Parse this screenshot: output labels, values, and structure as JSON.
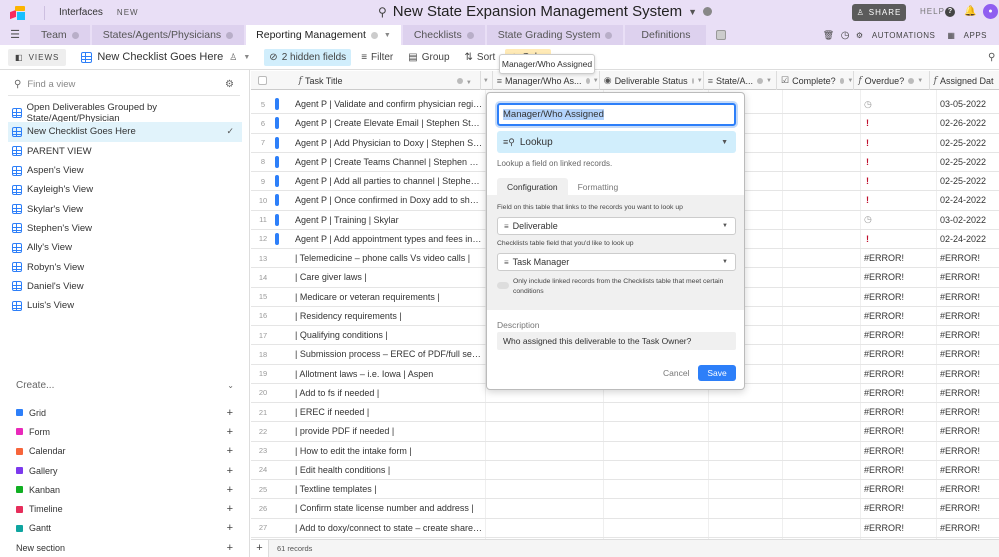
{
  "topbar": {
    "interfaces_label": "Interfaces",
    "new_badge": "NEW",
    "base_title": "New State Expansion Management System",
    "share_label": "SHARE",
    "help_label": "HELP"
  },
  "tabs": [
    {
      "label": "Team",
      "active": false
    },
    {
      "label": "States/Agents/Physicians",
      "active": false
    },
    {
      "label": "Reporting Management",
      "active": true
    },
    {
      "label": "Checklists",
      "active": false
    },
    {
      "label": "State Grading System",
      "active": false
    },
    {
      "label": "Definitions",
      "active": false
    }
  ],
  "tab_actions": {
    "automations_label": "AUTOMATIONS",
    "apps_label": "APPS"
  },
  "toolbar": {
    "views_label": "VIEWS",
    "current_view": "New Checklist Goes Here",
    "hidden_fields_label": "2 hidden fields",
    "filter_label": "Filter",
    "group_label": "Group",
    "sort_label": "Sort",
    "color_label": "Color"
  },
  "tooltip": "Manager/Who Assigned",
  "sidebar": {
    "find_placeholder": "Find a view",
    "views": [
      {
        "label": "Open Deliverables Grouped by State/Agent/Physician",
        "active": false
      },
      {
        "label": "New Checklist Goes Here",
        "active": true
      },
      {
        "label": "PARENT VIEW",
        "active": false
      },
      {
        "label": "Aspen's View",
        "active": false
      },
      {
        "label": "Kayleigh's View",
        "active": false
      },
      {
        "label": "Skylar's View",
        "active": false
      },
      {
        "label": "Stephen's View",
        "active": false
      },
      {
        "label": "Ally's View",
        "active": false
      },
      {
        "label": "Robyn's View",
        "active": false
      },
      {
        "label": "Daniel's View",
        "active": false
      },
      {
        "label": "Luis's View",
        "active": false
      }
    ],
    "create_label": "Create...",
    "create_items": [
      {
        "label": "Grid",
        "color": "#2d7ff9"
      },
      {
        "label": "Form",
        "color": "#e929ba"
      },
      {
        "label": "Calendar",
        "color": "#f7653b"
      },
      {
        "label": "Gallery",
        "color": "#7c39ed"
      },
      {
        "label": "Kanban",
        "color": "#11af22"
      },
      {
        "label": "Timeline",
        "color": "#e62e5b"
      },
      {
        "label": "Gantt",
        "color": "#0fa5a0"
      }
    ],
    "new_section_label": "New section"
  },
  "grid": {
    "columns": [
      {
        "label": "Task Title",
        "icon": "formula"
      },
      {
        "label": "Manager/Who As...",
        "icon": "lookup"
      },
      {
        "label": "Deliverable Status",
        "icon": "single-select"
      },
      {
        "label": "State/A...",
        "icon": "link"
      },
      {
        "label": "Complete?",
        "icon": "checkbox"
      },
      {
        "label": "Overdue?",
        "icon": "formula"
      },
      {
        "label": "Assigned Dat",
        "icon": "formula"
      }
    ],
    "rows": [
      {
        "num": "5",
        "title": "Agent P | Validate and confirm physician registration",
        "overdue": "clock",
        "assigned": "03-05-2022",
        "flag": true
      },
      {
        "num": "6",
        "title": "Agent P | Create Elevate Email | Stephen Stearman",
        "overdue": "!",
        "assigned": "02-26-2022",
        "flag": true
      },
      {
        "num": "7",
        "title": "Agent P | Add Physician to Doxy | Stephen Stearman",
        "overdue": "!",
        "assigned": "02-25-2022",
        "flag": true
      },
      {
        "num": "8",
        "title": "Agent P | Create Teams Channel | Stephen Stearman",
        "overdue": "!",
        "assigned": "02-25-2022",
        "flag": true
      },
      {
        "num": "9",
        "title": "Agent P | Add all parties to channel | Stephen Stearman",
        "overdue": "!",
        "assigned": "02-25-2022",
        "flag": true
      },
      {
        "num": "10",
        "title": "Agent P | Once confirmed in Doxy add to shared resources",
        "overdue": "!",
        "assigned": "02-24-2022",
        "flag": true
      },
      {
        "num": "11",
        "title": "Agent P | Training | Skylar",
        "overdue": "clock",
        "assigned": "03-02-2022",
        "flag": true
      },
      {
        "num": "12",
        "title": "Agent P | Add appointment types and fees in App...",
        "overdue": "!",
        "assigned": "02-24-2022",
        "flag": true
      },
      {
        "num": "13",
        "title": "|  Telemedicine – phone calls Vs video calls |",
        "overdue": "#ERROR!",
        "assigned": "#ERROR!",
        "flag": false
      },
      {
        "num": "14",
        "title": "| Care giver laws |",
        "overdue": "#ERROR!",
        "assigned": "#ERROR!",
        "flag": false
      },
      {
        "num": "15",
        "title": "| Medicare or veteran requirements |",
        "overdue": "#ERROR!",
        "assigned": "#ERROR!",
        "flag": false
      },
      {
        "num": "16",
        "title": "| Residency requirements |",
        "overdue": "#ERROR!",
        "assigned": "#ERROR!",
        "flag": false
      },
      {
        "num": "17",
        "title": "| Qualifying conditions |",
        "overdue": "#ERROR!",
        "assigned": "#ERROR!",
        "flag": false
      },
      {
        "num": "18",
        "title": "| Submission process – EREC of PDF/full service |",
        "overdue": "#ERROR!",
        "assigned": "#ERROR!",
        "flag": false
      },
      {
        "num": "19",
        "title": "| Allotment laws – i.e. Iowa | Aspen",
        "overdue": "#ERROR!",
        "assigned": "#ERROR!",
        "flag": false
      },
      {
        "num": "20",
        "title": "| Add to fs if needed |",
        "overdue": "#ERROR!",
        "assigned": "#ERROR!",
        "flag": false
      },
      {
        "num": "21",
        "title": "| EREC if needed |",
        "overdue": "#ERROR!",
        "assigned": "#ERROR!",
        "flag": false
      },
      {
        "num": "22",
        "title": "| provide PDF if needed |",
        "overdue": "#ERROR!",
        "assigned": "#ERROR!",
        "flag": false
      },
      {
        "num": "23",
        "title": "| How to edit the intake form |",
        "overdue": "#ERROR!",
        "assigned": "#ERROR!",
        "flag": false
      },
      {
        "num": "24",
        "title": "| Edit health conditions |",
        "overdue": "#ERROR!",
        "assigned": "#ERROR!",
        "flag": false
      },
      {
        "num": "25",
        "title": "| Textline templates |",
        "overdue": "#ERROR!",
        "assigned": "#ERROR!",
        "flag": false
      },
      {
        "num": "26",
        "title": "| Confirm state license number and address |",
        "overdue": "#ERROR!",
        "assigned": "#ERROR!",
        "flag": false
      },
      {
        "num": "27",
        "title": "| Add to doxy/connect to state – create shared ro...",
        "overdue": "#ERROR!",
        "assigned": "#ERROR!",
        "flag": false
      }
    ],
    "record_count": "61 records"
  },
  "field_panel": {
    "field_name": "Manager/Who Assigned",
    "field_type": "Lookup",
    "type_description": "Lookup a field on linked records.",
    "tabs": [
      "Configuration",
      "Formatting"
    ],
    "link_field_label": "Field on this table that links to the records you want to look up",
    "link_field_value": "Deliverable",
    "lookup_field_label": "Checklists table field that you'd like to look up",
    "lookup_field_value": "Task Manager",
    "condition_toggle_text": "Only include linked records from the Checklists table that meet certain conditions",
    "condition_toggle_on": false,
    "description_label": "Description",
    "description_value": "Who assigned this deliverable to the Task Owner?",
    "cancel_label": "Cancel",
    "save_label": "Save"
  }
}
